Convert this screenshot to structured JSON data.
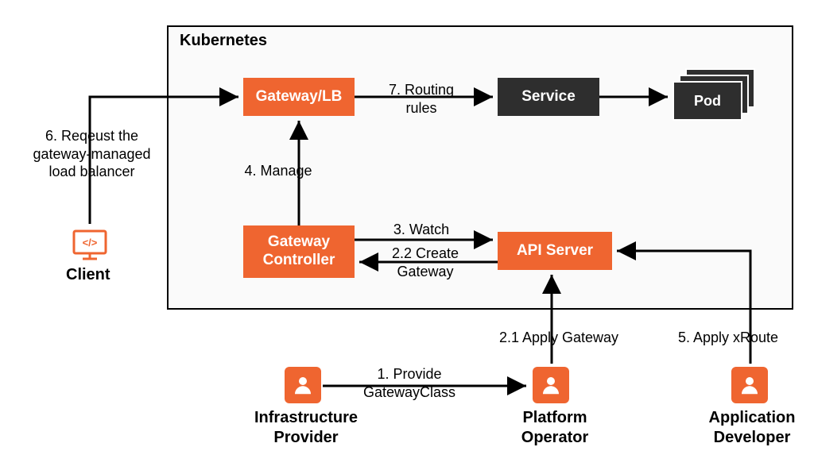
{
  "container": {
    "title": "Kubernetes"
  },
  "nodes": {
    "gatewaylb": "Gateway/LB",
    "service": "Service",
    "pod": "Pod",
    "gateway_controller": "Gateway\nController",
    "api_server": "API Server"
  },
  "actors": {
    "client": "Client",
    "infra_provider": "Infrastructure\nProvider",
    "platform_operator": "Platform\nOperator",
    "app_developer": "Application\nDeveloper"
  },
  "edges": {
    "e1": "1. Provide\nGatewayClass",
    "e21": "2.1 Apply Gateway",
    "e22": "2.2 Create\nGateway",
    "e3": "3. Watch",
    "e4": "4. Manage",
    "e5": "5. Apply xRoute",
    "e6": "6. Reqeust the\ngateway-managed\nload balancer",
    "e7": "7. Routing\nrules"
  },
  "colors": {
    "accent": "#ef6530",
    "dark": "#2e2e2e"
  }
}
